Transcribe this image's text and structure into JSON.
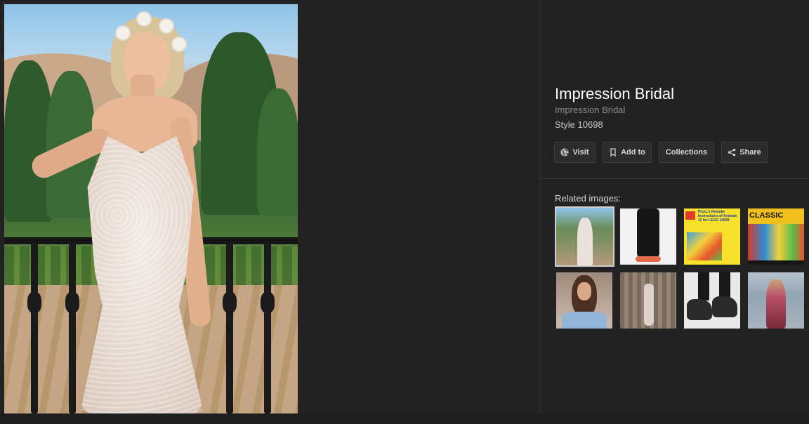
{
  "preview": {
    "title": "Impression Bridal",
    "source": "Impression Bridal",
    "style_code": "Style 10698"
  },
  "actions": {
    "visit": "Visit",
    "add_to": "Add to",
    "collections": "Collections",
    "share": "Share"
  },
  "icons": {
    "visit": "globe-icon",
    "add_to": "bookmark-icon",
    "share": "share-icon"
  },
  "related": {
    "label": "Related images:",
    "thumb_3_text": "PlusL's Remake Instructions of Animals 12 for LEGO 10698",
    "thumb_4_text": "CLASSIC"
  },
  "colors": {
    "background": "#222222",
    "text_primary": "#ffffff",
    "text_secondary": "#8a8a8a"
  }
}
